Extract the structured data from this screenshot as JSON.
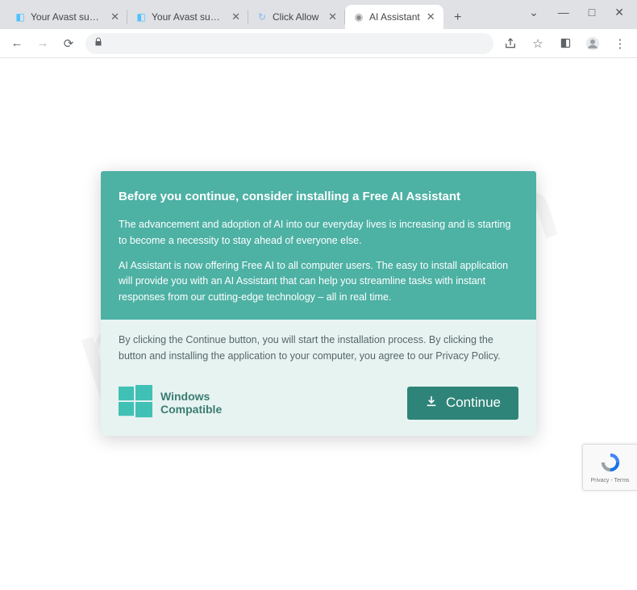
{
  "window": {
    "controls": {
      "chevron": "⌄",
      "minimize": "—",
      "maximize": "□",
      "close": "✕"
    }
  },
  "tabs": {
    "items": [
      {
        "title": "Your Avast subscription",
        "favicon_color": "#4cc2ff",
        "favicon_text": "◧"
      },
      {
        "title": "Your Avast subscription",
        "favicon_color": "#4cc2ff",
        "favicon_text": "◧"
      },
      {
        "title": "Click Allow",
        "favicon_color": "#8ab4f8",
        "favicon_text": "↻"
      },
      {
        "title": "AI Assistant",
        "favicon_color": "#8a8a8a",
        "favicon_text": "◉"
      }
    ],
    "active_index": 3,
    "new_tab": "+"
  },
  "toolbar": {
    "back": "←",
    "forward": "→",
    "reload": "⟳",
    "lock": "🔒",
    "share": "⇧",
    "star": "☆",
    "extensions": "◧",
    "profile": "◯",
    "menu": "⋮"
  },
  "modal": {
    "heading": "Before you continue, consider installing a Free AI Assistant",
    "para1": "The advancement and adoption of AI into our everyday lives is increasing and is starting to become a necessity to stay ahead of everyone else.",
    "para2": "AI Assistant is now offering Free AI to all computer users. The easy to install application will provide you with an AI Assistant that can help you streamline tasks with instant responses from our cutting-edge technology – all in real time.",
    "consent": "By clicking the Continue button, you will start the installation process. By clicking the button and installing the application to your computer, you agree to our Privacy Policy.",
    "compat_line1": "Windows",
    "compat_line2": "Compatible",
    "continue_label": "Continue"
  },
  "recaptcha": {
    "label": "Privacy - Terms"
  },
  "watermark": "pcrisk.com"
}
